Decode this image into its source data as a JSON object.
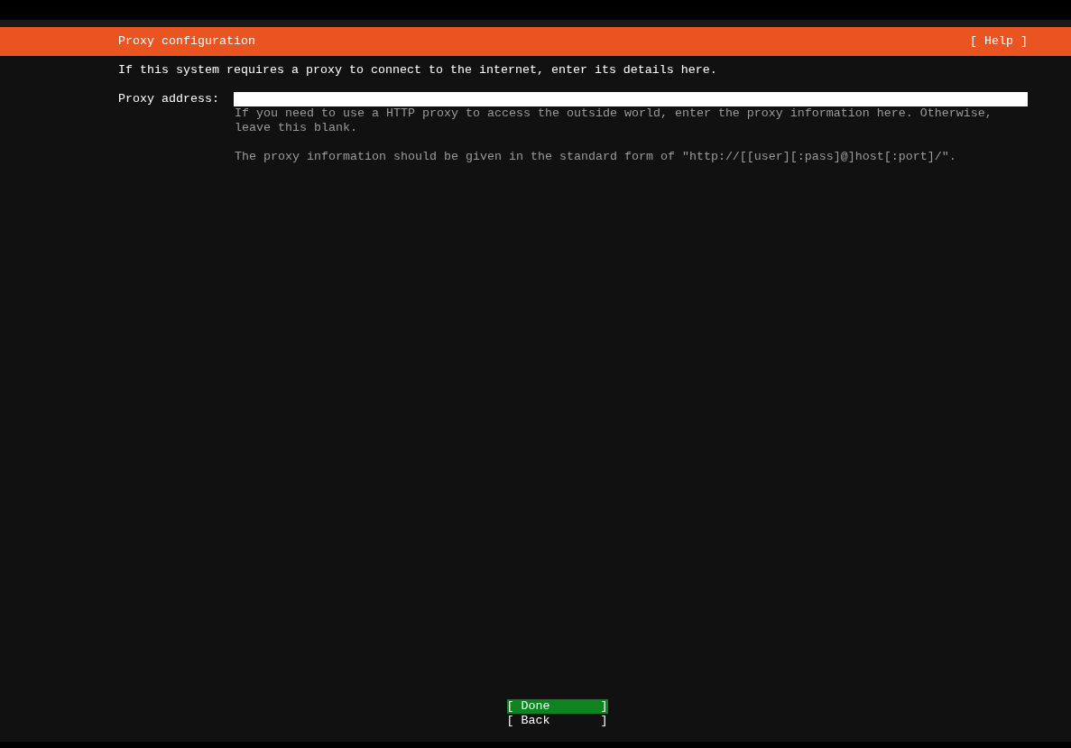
{
  "header": {
    "title": "Proxy configuration",
    "help": "[ Help ]"
  },
  "intro": "If this system requires a proxy to connect to the internet, enter its details here.",
  "proxy_field": {
    "label": "Proxy address:"
  },
  "hints": [
    "If you need to use a HTTP proxy to access the outside world, enter the proxy information here. Otherwise, leave this blank.",
    "The proxy information should be given in the standard form of \"http://[[user][:pass]@]host[:port]/\"."
  ],
  "buttons": [
    {
      "label": "[ Done       ]",
      "selected": true
    },
    {
      "label": "[ Back       ]",
      "selected": false
    }
  ]
}
